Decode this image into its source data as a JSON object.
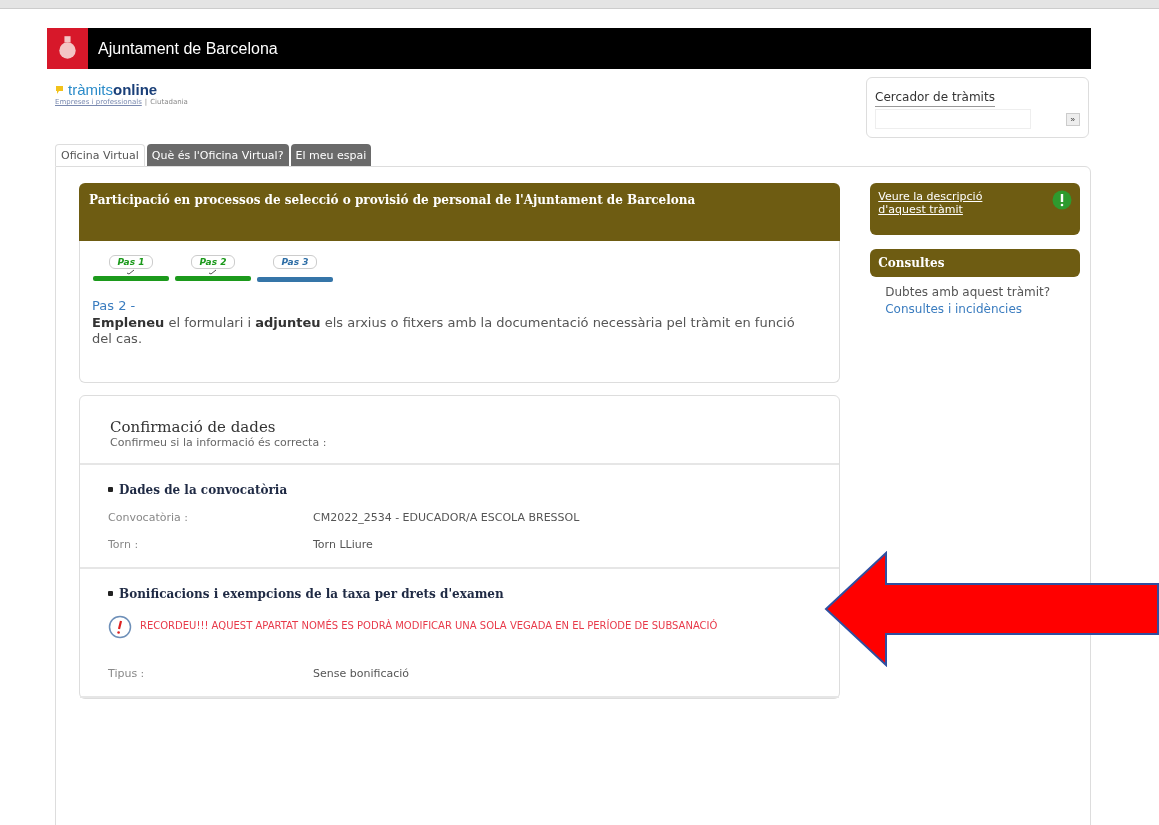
{
  "header": {
    "title": "Ajuntament de Barcelona"
  },
  "brand": {
    "name_part": "tràmits",
    "name_accent": "online",
    "link": "Empreses i professionals",
    "separator": "|",
    "other": "Ciutadania"
  },
  "search": {
    "label": "Cercador de tràmits",
    "button": "»"
  },
  "tabs": [
    {
      "label": "Oficina Virtual",
      "selected": true
    },
    {
      "label": "Què és l'Oficina Virtual?",
      "selected": false
    },
    {
      "label": "El meu espai",
      "selected": false
    }
  ],
  "procedure_title": "Participació en processos de selecció o provisió de personal de l'Ajuntament de Barcelona",
  "steps": [
    {
      "label": "Pas 1",
      "done": true
    },
    {
      "label": "Pas 2",
      "done": true
    },
    {
      "label": "Pas 3",
      "done": false
    }
  ],
  "step_heading": "Pas 2 -",
  "step_text": "**Empleneu** el formulari i **adjunteu** els arxius o fitxers amb la documentació necessària pel tràmit en funció del cas.",
  "confirmation": {
    "title": "Confirmació de dades",
    "subtitle": "Confirmeu si la informació és correcta :",
    "sections": [
      {
        "heading": "Dades de la convocatòria",
        "fields": [
          {
            "label": "Convocatòria :",
            "value": "CM2022_2534 - EDUCADOR/A ESCOLA BRESSOL"
          },
          {
            "label": "Torn :",
            "value": "Torn LLiure"
          }
        ]
      },
      {
        "heading": "Bonificacions i exempcions de la taxa per drets d'examen",
        "warning": "RECORDEU!!! AQUEST APARTAT NOMÉS ES PODRÀ MODIFICAR UNA SOLA VEGADA EN EL PERÍODE DE SUBSANACIÓ",
        "fields": [
          {
            "label": "Tipus :",
            "value": "Sense bonificació"
          }
        ]
      }
    ]
  },
  "sidebar": {
    "description_link": "Veure la descripció d'aquest tràmit",
    "consult_title": "Consultes",
    "consult_text": "Dubtes amb aquest tràmit?",
    "consult_link": "Consultes i incidències"
  }
}
